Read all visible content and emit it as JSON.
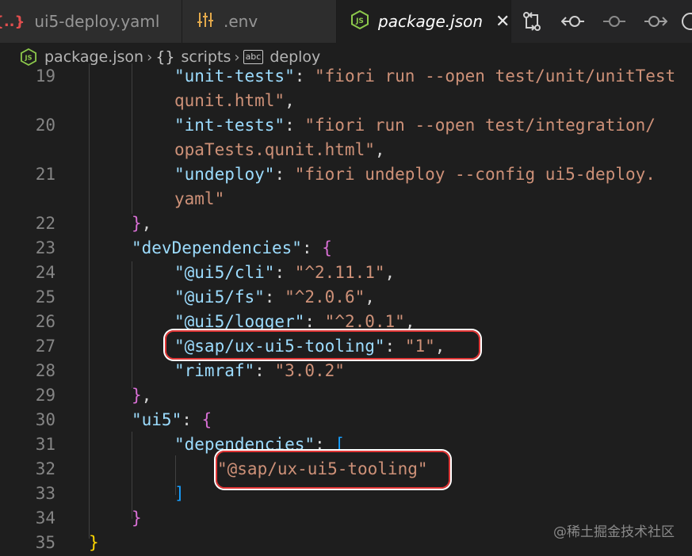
{
  "tabs": [
    {
      "label": "ui5-deploy.yaml",
      "icon": "{..}"
    },
    {
      "label": ".env",
      "icon": "⫶"
    },
    {
      "label": "package.json",
      "icon": "JS",
      "active": true
    }
  ],
  "breadcrumb": {
    "file": "package.json",
    "section_icon": "{}",
    "section": "scripts",
    "item_icon": "abc",
    "item": "deploy"
  },
  "code_lines": [
    {
      "num": "19",
      "tokens": [
        {
          "t": "\"unit-tests\"",
          "c": "key"
        },
        {
          "t": ": ",
          "c": "pun"
        },
        {
          "t": "\"fiori run --open test/unit/unitTest",
          "c": "str"
        }
      ]
    },
    {
      "num": "",
      "tokens": [
        {
          "t": "qunit.html\"",
          "c": "str"
        },
        {
          "t": ",",
          "c": "pun"
        }
      ]
    },
    {
      "num": "20",
      "tokens": [
        {
          "t": "\"int-tests\"",
          "c": "key"
        },
        {
          "t": ": ",
          "c": "pun"
        },
        {
          "t": "\"fiori run --open test/integration/",
          "c": "str"
        }
      ]
    },
    {
      "num": "",
      "tokens": [
        {
          "t": "opaTests.qunit.html\"",
          "c": "str"
        },
        {
          "t": ",",
          "c": "pun"
        }
      ]
    },
    {
      "num": "21",
      "tokens": [
        {
          "t": "\"undeploy\"",
          "c": "key"
        },
        {
          "t": ": ",
          "c": "pun"
        },
        {
          "t": "\"fiori undeploy --config ui5-deploy.",
          "c": "str"
        }
      ]
    },
    {
      "num": "",
      "tokens": [
        {
          "t": "yaml\"",
          "c": "str"
        }
      ]
    },
    {
      "num": "22",
      "tokens": [
        {
          "t": "}",
          "c": "br2"
        },
        {
          "t": ",",
          "c": "pun"
        }
      ]
    },
    {
      "num": "23",
      "tokens": [
        {
          "t": "\"devDependencies\"",
          "c": "key"
        },
        {
          "t": ": ",
          "c": "pun"
        },
        {
          "t": "{",
          "c": "br2"
        }
      ]
    },
    {
      "num": "24",
      "tokens": [
        {
          "t": "\"@ui5/cli\"",
          "c": "key"
        },
        {
          "t": ": ",
          "c": "pun"
        },
        {
          "t": "\"^2.11.1\"",
          "c": "str"
        },
        {
          "t": ",",
          "c": "pun"
        }
      ]
    },
    {
      "num": "25",
      "tokens": [
        {
          "t": "\"@ui5/fs\"",
          "c": "key"
        },
        {
          "t": ": ",
          "c": "pun"
        },
        {
          "t": "\"^2.0.6\"",
          "c": "str"
        },
        {
          "t": ",",
          "c": "pun"
        }
      ]
    },
    {
      "num": "26",
      "tokens": [
        {
          "t": "\"@ui5/logger\"",
          "c": "key"
        },
        {
          "t": ": ",
          "c": "pun"
        },
        {
          "t": "\"^2.0.1\"",
          "c": "str"
        },
        {
          "t": ",",
          "c": "pun"
        }
      ]
    },
    {
      "num": "27",
      "tokens": [
        {
          "t": "\"@sap/ux-ui5-tooling\"",
          "c": "key"
        },
        {
          "t": ": ",
          "c": "pun"
        },
        {
          "t": "\"1\"",
          "c": "str"
        },
        {
          "t": ",",
          "c": "pun"
        }
      ]
    },
    {
      "num": "28",
      "tokens": [
        {
          "t": "\"rimraf\"",
          "c": "key"
        },
        {
          "t": ": ",
          "c": "pun"
        },
        {
          "t": "\"3.0.2\"",
          "c": "str"
        }
      ]
    },
    {
      "num": "29",
      "tokens": [
        {
          "t": "}",
          "c": "br2"
        },
        {
          "t": ",",
          "c": "pun"
        }
      ]
    },
    {
      "num": "30",
      "tokens": [
        {
          "t": "\"ui5\"",
          "c": "key"
        },
        {
          "t": ": ",
          "c": "pun"
        },
        {
          "t": "{",
          "c": "br2"
        }
      ]
    },
    {
      "num": "31",
      "tokens": [
        {
          "t": "\"dependencies\"",
          "c": "key"
        },
        {
          "t": ": ",
          "c": "pun"
        },
        {
          "t": "[",
          "c": "br3"
        }
      ]
    },
    {
      "num": "32",
      "tokens": [
        {
          "t": "\"@sap/ux-ui5-tooling\"",
          "c": "str"
        }
      ]
    },
    {
      "num": "33",
      "tokens": [
        {
          "t": "]",
          "c": "br3"
        }
      ]
    },
    {
      "num": "34",
      "tokens": [
        {
          "t": "}",
          "c": "br2"
        }
      ]
    },
    {
      "num": "35",
      "tokens": [
        {
          "t": "}",
          "c": "br1"
        }
      ]
    }
  ],
  "watermark": "@稀土掘金技术社区"
}
